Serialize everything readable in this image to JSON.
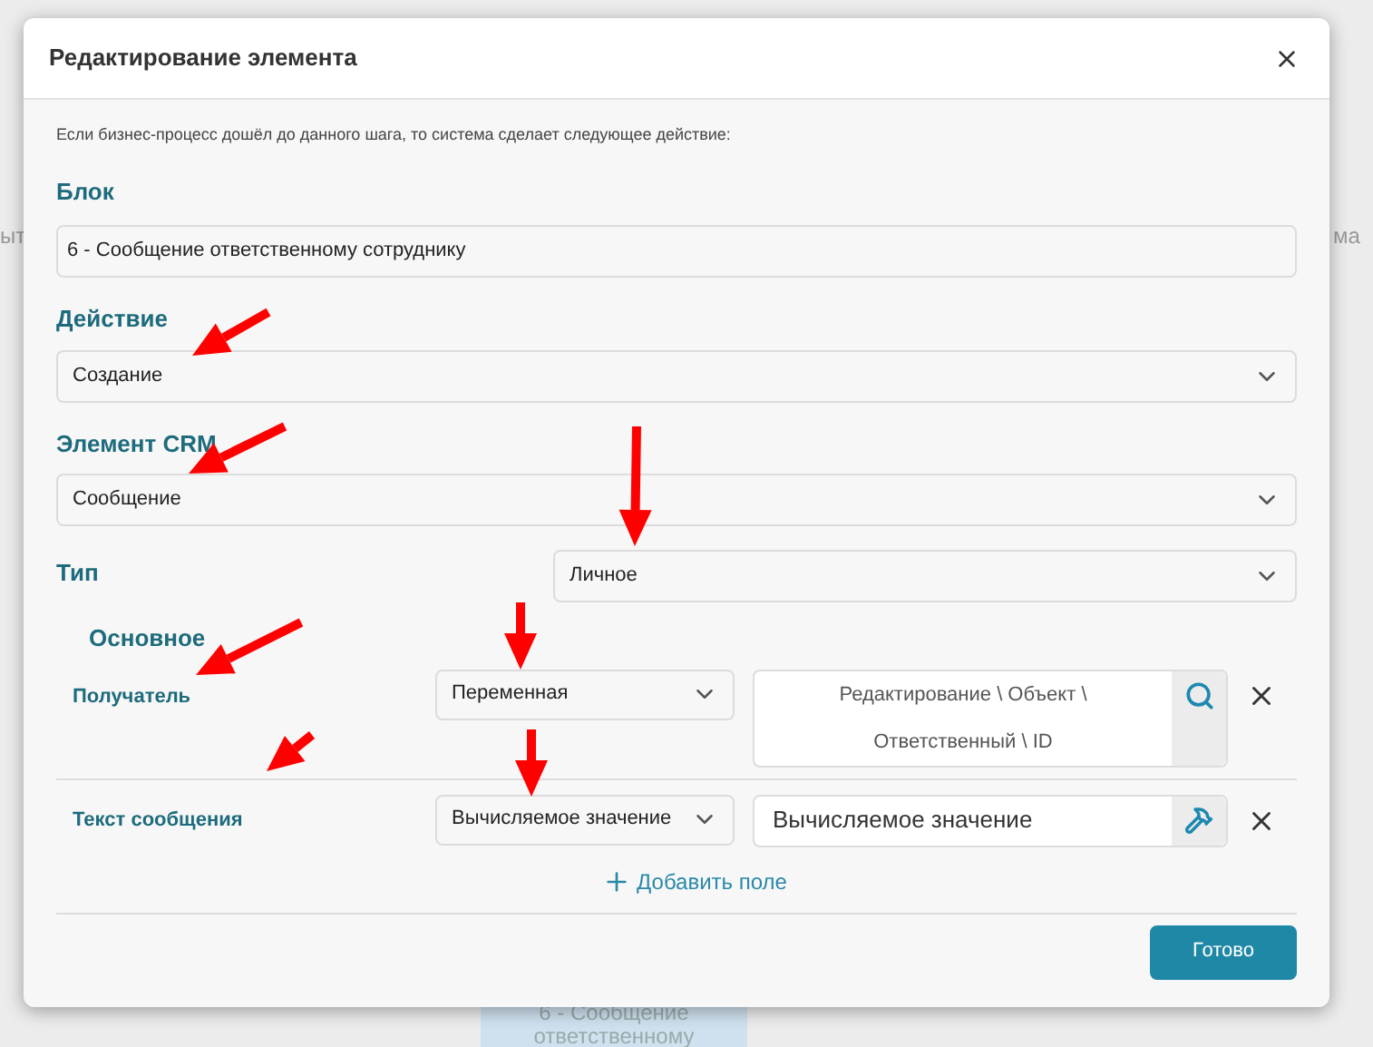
{
  "background": {
    "left_text": "ыт",
    "right_text": "ма",
    "node": "6 - Сообщение ответственному"
  },
  "dialog": {
    "title": "Редактирование элемента",
    "intro": "Если бизнес-процесс дошёл до данного шага, то система сделает следующее действие:",
    "block": {
      "label": "Блок",
      "value": "6 - Сообщение ответственному сотруднику"
    },
    "action": {
      "label": "Действие",
      "value": "Создание"
    },
    "crm_element": {
      "label": "Элемент CRM",
      "value": "Сообщение"
    },
    "type": {
      "label": "Тип",
      "value": "Личное"
    },
    "section": "Основное",
    "fields": [
      {
        "label": "Получатель",
        "mode": "Переменная",
        "kind": "search",
        "value": "Редактирование \\ Объект \\ Ответственный \\ ID"
      },
      {
        "label": "Текст сообщения",
        "mode": "Вычисляемое значение",
        "kind": "calc",
        "value": "Вычисляемое значение"
      }
    ],
    "add_field": "Добавить поле",
    "ok": "Готово"
  }
}
